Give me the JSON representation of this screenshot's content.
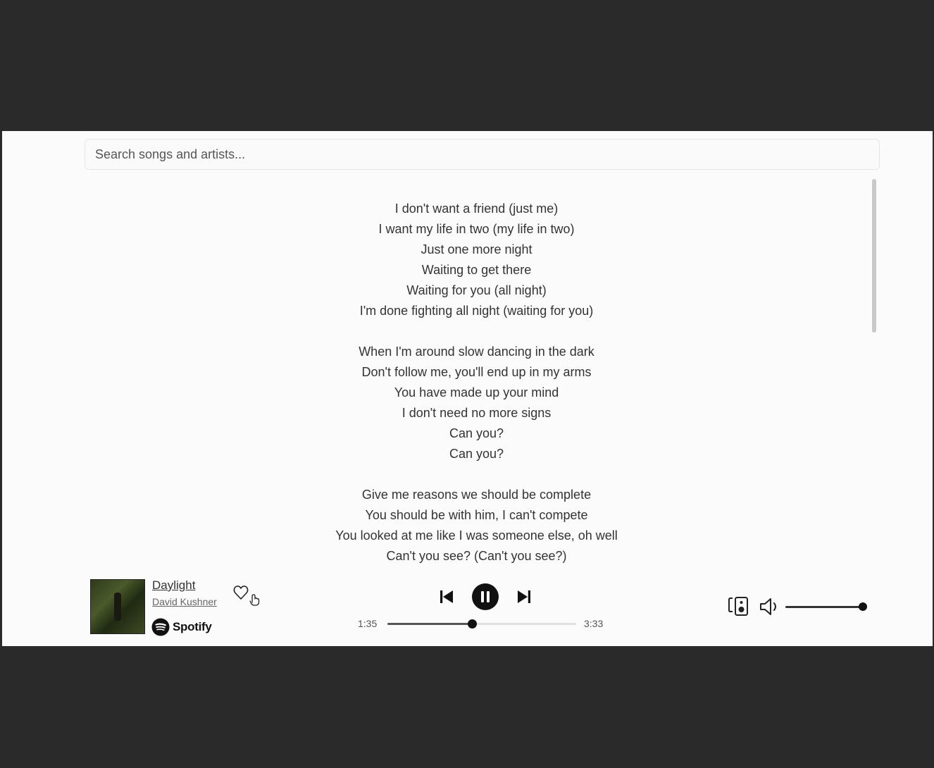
{
  "search": {
    "placeholder": "Search songs and artists..."
  },
  "lyrics": {
    "stanzas": [
      [
        "I don't want a friend (just me)",
        "I want my life in two (my life in two)",
        "Just one more night",
        "Waiting to get there",
        "Waiting for you (all night)",
        "I'm done fighting all night (waiting for you)"
      ],
      [
        "When I'm around slow dancing in the dark",
        "Don't follow me, you'll end up in my arms",
        "You have made up your mind",
        "I don't need no more signs",
        "Can you?",
        "Can you?"
      ],
      [
        "Give me reasons we should be complete",
        "You should be with him, I can't compete",
        "You looked at me like I was someone else, oh well",
        "Can't you see? (Can't you see?)"
      ]
    ]
  },
  "now_playing": {
    "title": "Daylight",
    "artist": "David Kushner",
    "source_label": "Spotify",
    "liked": false
  },
  "playback": {
    "state": "playing",
    "current_time": "1:35",
    "total_time": "3:33",
    "progress": 0.446
  },
  "volume": {
    "level": 1.0
  },
  "icons": {
    "album_art": "album-art",
    "spotify": "spotify-logo-icon",
    "heart": "heart-icon",
    "previous": "skip-previous-icon",
    "pause": "pause-icon",
    "next": "skip-next-icon",
    "device": "connect-device-icon",
    "volume": "volume-icon"
  },
  "colors": {
    "background_outer": "#2a2a2a",
    "background_panel": "#fbfbfb",
    "text": "#333333",
    "accent_dark": "#111111"
  }
}
